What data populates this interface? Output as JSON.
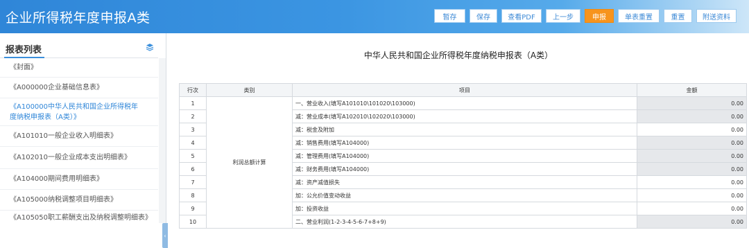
{
  "header": {
    "title": "企业所得税年度申报A类",
    "buttons": [
      {
        "label": "暂存",
        "active": false
      },
      {
        "label": "保存",
        "active": false
      },
      {
        "label": "查看PDF",
        "active": false
      },
      {
        "label": "上一步",
        "active": false
      },
      {
        "label": "申报",
        "active": true
      },
      {
        "label": "单表重置",
        "active": false
      },
      {
        "label": "重置",
        "active": false
      },
      {
        "label": "附送资料",
        "active": false
      }
    ]
  },
  "sidebar": {
    "title": "报表列表",
    "icon": "stack-icon",
    "items": [
      {
        "label": "《封面》",
        "active": false
      },
      {
        "label": "《A000000企业基础信息表》",
        "active": false
      },
      {
        "label": "《A100000中华人民共和国企业所得税年度纳税申报表（A类）》",
        "active": true
      },
      {
        "label": "《A101010一般企业收入明细表》",
        "active": false
      },
      {
        "label": "《A102010一般企业成本支出明细表》",
        "active": false
      },
      {
        "label": "《A104000期间费用明细表》",
        "active": false
      },
      {
        "label": "《A105000纳税调整项目明细表》",
        "active": false
      },
      {
        "label": "《A105050职工薪酬支出及纳税调整明细表》",
        "active": false
      }
    ],
    "collapse_glyph": "‹"
  },
  "form": {
    "title": "中华人民共和国企业所得税年度纳税申报表（A类）",
    "columns": [
      "行次",
      "类别",
      "项目",
      "金额"
    ],
    "category_label": "利润总额计算",
    "rows": [
      {
        "no": "1",
        "item": "一、营业收入(填写A101010\\101020\\103000)",
        "amount": "0.00",
        "calc": true
      },
      {
        "no": "2",
        "item": "减：营业成本(填写A102010\\102020\\103000)",
        "amount": "0.00",
        "calc": true
      },
      {
        "no": "3",
        "item": "减：税金及附加",
        "amount": "0.00",
        "calc": false
      },
      {
        "no": "4",
        "item": "减：销售费用(填写A104000)",
        "amount": "0.00",
        "calc": true
      },
      {
        "no": "5",
        "item": "减：管理费用(填写A104000)",
        "amount": "0.00",
        "calc": true
      },
      {
        "no": "6",
        "item": "减：财务费用(填写A104000)",
        "amount": "0.00",
        "calc": true
      },
      {
        "no": "7",
        "item": "减：资产减值损失",
        "amount": "0.00",
        "calc": false
      },
      {
        "no": "8",
        "item": "加：公允价值变动收益",
        "amount": "0.00",
        "calc": false
      },
      {
        "no": "9",
        "item": "加：投资收益",
        "amount": "0.00",
        "calc": false
      },
      {
        "no": "10",
        "item": "二、营业利润(1-2-3-4-5-6-7+8+9)",
        "amount": "0.00",
        "calc": true
      }
    ]
  },
  "colors": {
    "header_blue": "#2f86d8",
    "active_button": "#f7941d",
    "link_blue": "#2f86d8"
  }
}
